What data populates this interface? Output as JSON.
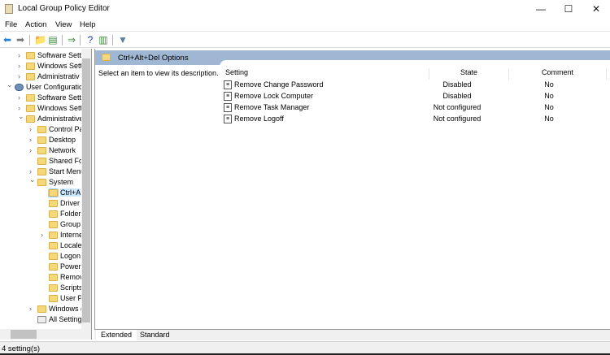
{
  "window": {
    "title": "Local Group Policy Editor",
    "minimize": "—",
    "maximize": "☐",
    "close": "✕"
  },
  "menu": [
    "File",
    "Action",
    "View",
    "Help"
  ],
  "toolbar": [
    {
      "icon": "back-icon",
      "glyph": "⬅",
      "color": "#2a7fd4"
    },
    {
      "icon": "forward-icon",
      "glyph": "➡",
      "color": "#777"
    },
    {
      "icon": "up-folder-icon",
      "glyph": "📁",
      "color": "#c8a030"
    },
    {
      "icon": "show-hide-tree-icon",
      "glyph": "▤",
      "color": "#3a8a3a"
    },
    {
      "icon": "export-list-icon",
      "glyph": "⇒",
      "color": "#3a8a3a"
    },
    {
      "icon": "help-icon",
      "glyph": "?",
      "color": "#1a3ea8"
    },
    {
      "icon": "properties-icon",
      "glyph": "▥",
      "color": "#3a8a3a"
    },
    {
      "icon": "filter-icon",
      "glyph": "▼",
      "color": "#5a7fa0"
    }
  ],
  "tree": [
    {
      "label": "Software Setti",
      "level": 2,
      "chev": ">"
    },
    {
      "label": "Windows Sett",
      "level": 2,
      "chev": ">"
    },
    {
      "label": "Administrativ",
      "level": 2,
      "chev": ">"
    },
    {
      "label": "User Configuratio",
      "level": 1,
      "chev": "v",
      "icon": "user"
    },
    {
      "label": "Software Setti",
      "level": 2,
      "chev": ">"
    },
    {
      "label": "Windows Sett",
      "level": 2,
      "chev": ">"
    },
    {
      "label": "Administrative",
      "level": 2,
      "chev": "v"
    },
    {
      "label": "Control Pa",
      "level": 3,
      "chev": ">"
    },
    {
      "label": "Desktop",
      "level": 3,
      "chev": ">"
    },
    {
      "label": "Network",
      "level": 3,
      "chev": ">"
    },
    {
      "label": "Shared Fol",
      "level": 3,
      "chev": ""
    },
    {
      "label": "Start Menu",
      "level": 3,
      "chev": ">"
    },
    {
      "label": "System",
      "level": 3,
      "chev": "v"
    },
    {
      "label": "Ctrl+A",
      "level": 4,
      "chev": "",
      "selected": true
    },
    {
      "label": "Driver",
      "level": 4,
      "chev": ""
    },
    {
      "label": "Folder",
      "level": 4,
      "chev": ""
    },
    {
      "label": "Group",
      "level": 4,
      "chev": ""
    },
    {
      "label": "Interne",
      "level": 4,
      "chev": ">"
    },
    {
      "label": "Locale",
      "level": 4,
      "chev": ""
    },
    {
      "label": "Logon",
      "level": 4,
      "chev": ""
    },
    {
      "label": "Power",
      "level": 4,
      "chev": ""
    },
    {
      "label": "Remov",
      "level": 4,
      "chev": ""
    },
    {
      "label": "Scripts",
      "level": 4,
      "chev": ""
    },
    {
      "label": "User Pr",
      "level": 4,
      "chev": ""
    },
    {
      "label": "Windows (",
      "level": 3,
      "chev": ">"
    },
    {
      "label": "All Setting",
      "level": 3,
      "chev": "",
      "icon": "all"
    }
  ],
  "details": {
    "header": "Ctrl+Alt+Del Options",
    "description": "Select an item to view its description.",
    "columns": {
      "setting": "Setting",
      "state": "State",
      "comment": "Comment"
    },
    "rows": [
      {
        "setting": "Remove Change Password",
        "state": "Disabled",
        "comment": "No"
      },
      {
        "setting": "Remove Lock Computer",
        "state": "Disabled",
        "comment": "No"
      },
      {
        "setting": "Remove Task Manager",
        "state": "Not configured",
        "comment": "No"
      },
      {
        "setting": "Remove Logoff",
        "state": "Not configured",
        "comment": "No"
      }
    ]
  },
  "tabs": [
    "Extended",
    "Standard"
  ],
  "status": "4 setting(s)"
}
